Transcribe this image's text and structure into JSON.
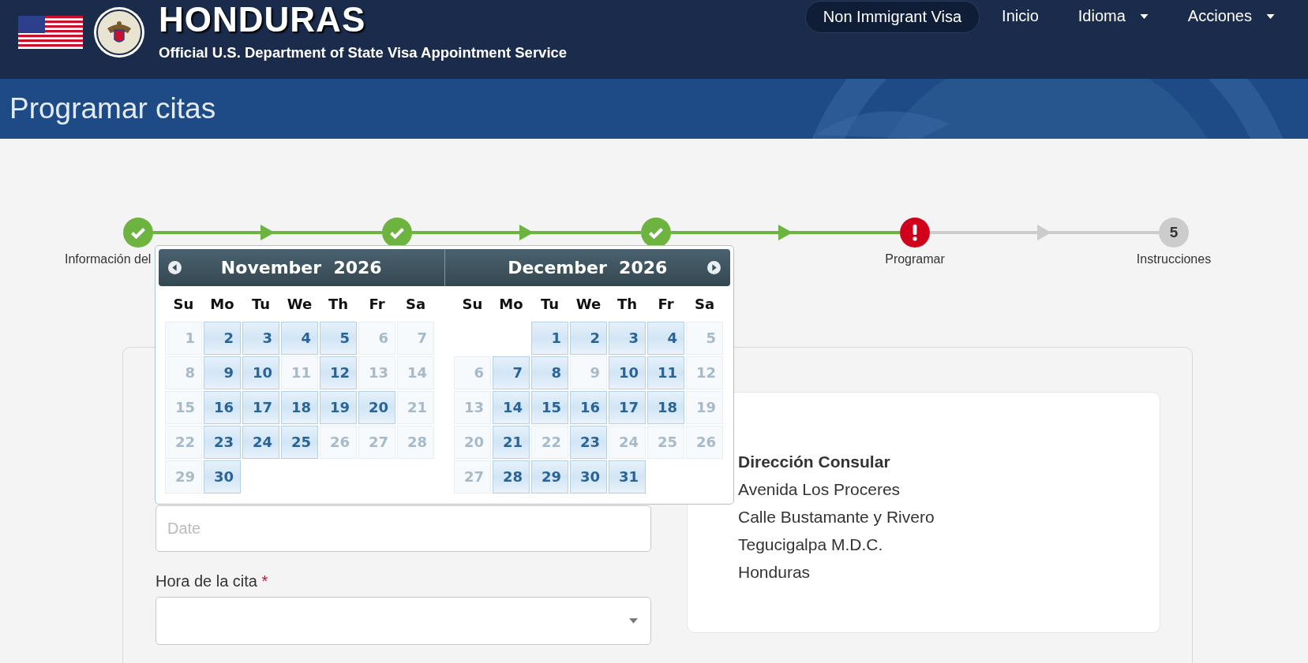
{
  "header": {
    "title": "HONDURAS",
    "subtitle": "Official U.S. Department of State Visa Appointment Service"
  },
  "nav": [
    {
      "label": "Non Immigrant Visa",
      "selected": true,
      "has_menu": false
    },
    {
      "label": "Inicio",
      "selected": false,
      "has_menu": false
    },
    {
      "label": "Idioma",
      "selected": false,
      "has_menu": true
    },
    {
      "label": "Acciones",
      "selected": false,
      "has_menu": true
    }
  ],
  "page_title": "Programar citas",
  "steps": [
    {
      "kind": "done",
      "label": "Información del"
    },
    {
      "kind": "done"
    },
    {
      "kind": "done"
    },
    {
      "kind": "error",
      "label": "Programar"
    },
    {
      "kind": "pending",
      "number": "5",
      "label": "Instrucciones"
    }
  ],
  "datepicker": {
    "months": [
      {
        "month": "November",
        "year": "2026",
        "weekdays": [
          "Su",
          "Mo",
          "Tu",
          "We",
          "Th",
          "Fr",
          "Sa"
        ],
        "weeks": [
          [
            {
              "day": "1",
              "available": false
            },
            {
              "day": "2",
              "available": true
            },
            {
              "day": "3",
              "available": true
            },
            {
              "day": "4",
              "available": true
            },
            {
              "day": "5",
              "available": true
            },
            {
              "day": "6",
              "available": false
            },
            {
              "day": "7",
              "available": false
            }
          ],
          [
            {
              "day": "8",
              "available": false
            },
            {
              "day": "9",
              "available": true
            },
            {
              "day": "10",
              "available": true
            },
            {
              "day": "11",
              "available": false
            },
            {
              "day": "12",
              "available": true
            },
            {
              "day": "13",
              "available": false
            },
            {
              "day": "14",
              "available": false
            }
          ],
          [
            {
              "day": "15",
              "available": false
            },
            {
              "day": "16",
              "available": true
            },
            {
              "day": "17",
              "available": true
            },
            {
              "day": "18",
              "available": true
            },
            {
              "day": "19",
              "available": true
            },
            {
              "day": "20",
              "available": true
            },
            {
              "day": "21",
              "available": false
            }
          ],
          [
            {
              "day": "22",
              "available": false
            },
            {
              "day": "23",
              "available": true
            },
            {
              "day": "24",
              "available": true
            },
            {
              "day": "25",
              "available": true
            },
            {
              "day": "26",
              "available": false
            },
            {
              "day": "27",
              "available": false
            },
            {
              "day": "28",
              "available": false
            }
          ],
          [
            {
              "day": "29",
              "available": false
            },
            {
              "day": "30",
              "available": true
            }
          ]
        ]
      },
      {
        "month": "December",
        "year": "2026",
        "weekdays": [
          "Su",
          "Mo",
          "Tu",
          "We",
          "Th",
          "Fr",
          "Sa"
        ],
        "weeks": [
          [
            {
              "kind": "empty"
            },
            {
              "kind": "empty"
            },
            {
              "day": "1",
              "available": true
            },
            {
              "day": "2",
              "available": true
            },
            {
              "day": "3",
              "available": true
            },
            {
              "day": "4",
              "available": true
            },
            {
              "day": "5",
              "available": false
            }
          ],
          [
            {
              "day": "6",
              "available": false
            },
            {
              "day": "7",
              "available": true
            },
            {
              "day": "8",
              "available": true
            },
            {
              "day": "9",
              "available": false
            },
            {
              "day": "10",
              "available": true
            },
            {
              "day": "11",
              "available": true
            },
            {
              "day": "12",
              "available": false
            }
          ],
          [
            {
              "day": "13",
              "available": false
            },
            {
              "day": "14",
              "available": true
            },
            {
              "day": "15",
              "available": true
            },
            {
              "day": "16",
              "available": true
            },
            {
              "day": "17",
              "available": true
            },
            {
              "day": "18",
              "available": true
            },
            {
              "day": "19",
              "available": false
            }
          ],
          [
            {
              "day": "20",
              "available": false
            },
            {
              "day": "21",
              "available": true
            },
            {
              "day": "22",
              "available": false
            },
            {
              "day": "23",
              "available": true
            },
            {
              "day": "24",
              "available": false
            },
            {
              "day": "25",
              "available": false
            },
            {
              "day": "26",
              "available": false
            }
          ],
          [
            {
              "day": "27",
              "available": false
            },
            {
              "day": "28",
              "available": true
            },
            {
              "day": "29",
              "available": true
            },
            {
              "day": "30",
              "available": true
            },
            {
              "day": "31",
              "available": true
            }
          ]
        ]
      }
    ]
  },
  "form": {
    "date_field": {
      "placeholder": "Date"
    },
    "time_field": {
      "label": "Hora de la cita",
      "required_mark": "*"
    }
  },
  "consulate": {
    "heading": "Dirección Consular",
    "lines": [
      "Avenida Los Proceres",
      "Calle Bustamante y Rivero",
      "Tegucigalpa M.D.C.",
      "Honduras"
    ]
  }
}
